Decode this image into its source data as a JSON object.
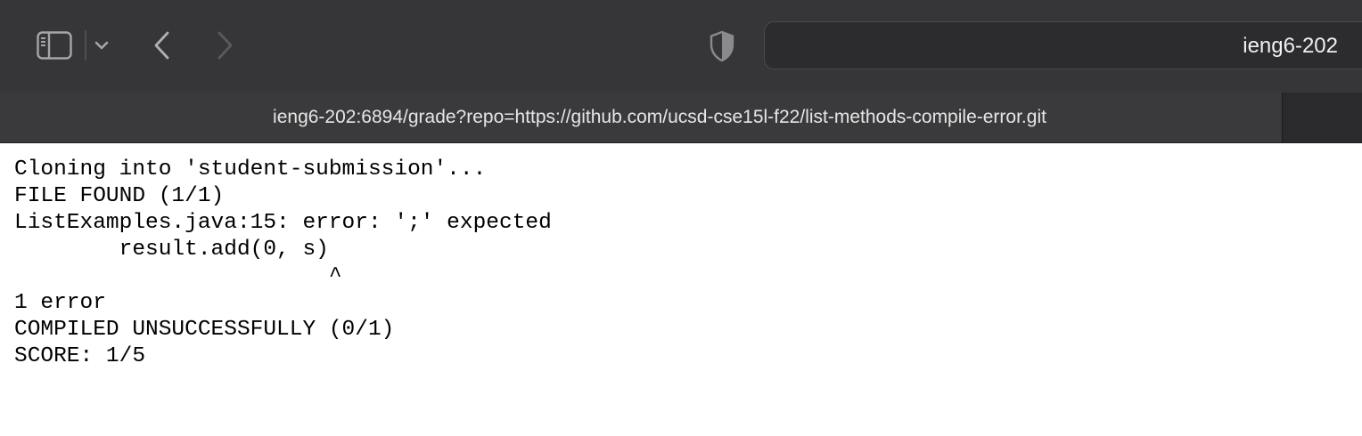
{
  "toolbar": {
    "sidebar_icon": "sidebar-toggle-icon",
    "dropdown_icon": "chevron-down-icon",
    "back_icon": "back-arrow-icon",
    "forward_icon": "forward-arrow-icon",
    "privacy_icon": "shield-icon",
    "address_text": "ieng6-202"
  },
  "tab": {
    "title": "ieng6-202:6894/grade?repo=https://github.com/ucsd-cse15l-f22/list-methods-compile-error.git"
  },
  "output": {
    "lines": [
      "Cloning into 'student-submission'...",
      "FILE FOUND (1/1)",
      "ListExamples.java:15: error: ';' expected",
      "        result.add(0, s)",
      "                        ^",
      "1 error",
      "COMPILED UNSUCCESSFULLY (0/1)",
      "SCORE: 1/5"
    ]
  },
  "colors": {
    "toolbar_bg": "#363638",
    "tabbar_bg": "#3a3a3c",
    "page_bg": "#ffffff"
  }
}
